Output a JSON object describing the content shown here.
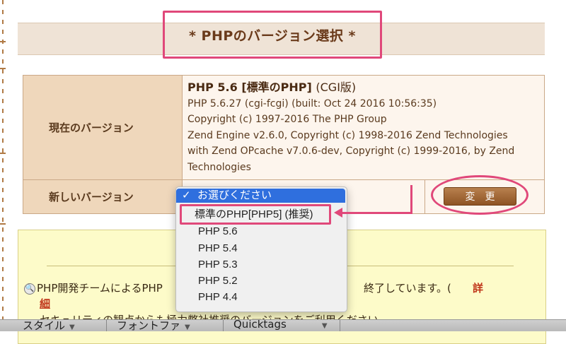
{
  "title": "* PHPのバージョン選択 *",
  "current": {
    "label": "現在のバージョン",
    "head": "PHP 5.6 [標準のPHP]",
    "head_suffix": "(CGI版)",
    "lines": [
      "PHP 5.6.27 (cgi-fcgi) (built: Oct 24 2016 10:56:35)",
      "Copyright (c) 1997-2016 The PHP Group",
      "Zend Engine v2.6.0, Copyright (c) 1998-2016 Zend Technologies",
      "with Zend OPcache v7.0.6-dev, Copyright (c) 1999-2016, by Zend",
      "Technologies"
    ]
  },
  "new_version": {
    "label": "新しいバージョン",
    "button": "変更"
  },
  "dropdown": {
    "check": "✓",
    "selected": "お選びください",
    "options": [
      "標準のPHP[PHP5] (推奨)",
      "PHP 5.6",
      "PHP 5.4",
      "PHP 5.3",
      "PHP 5.2",
      "PHP 4.4"
    ]
  },
  "notice": {
    "line1_start": "PHP開発チームによるPHP",
    "line1_end": "終了しています。(",
    "detail_1": "詳",
    "detail_2": "細",
    "line2": "セキュリティの観点からも極力弊社推奨のバージョンをご利用ください。"
  },
  "toolbar": {
    "style": "スタイル",
    "font": "フォントファ",
    "quicktags": "Quicktags"
  },
  "colors": {
    "highlight": "#e0487a",
    "selection": "#2f6fde",
    "label_bg": "#efd7bb",
    "notice_bg": "#fdfbc9"
  }
}
